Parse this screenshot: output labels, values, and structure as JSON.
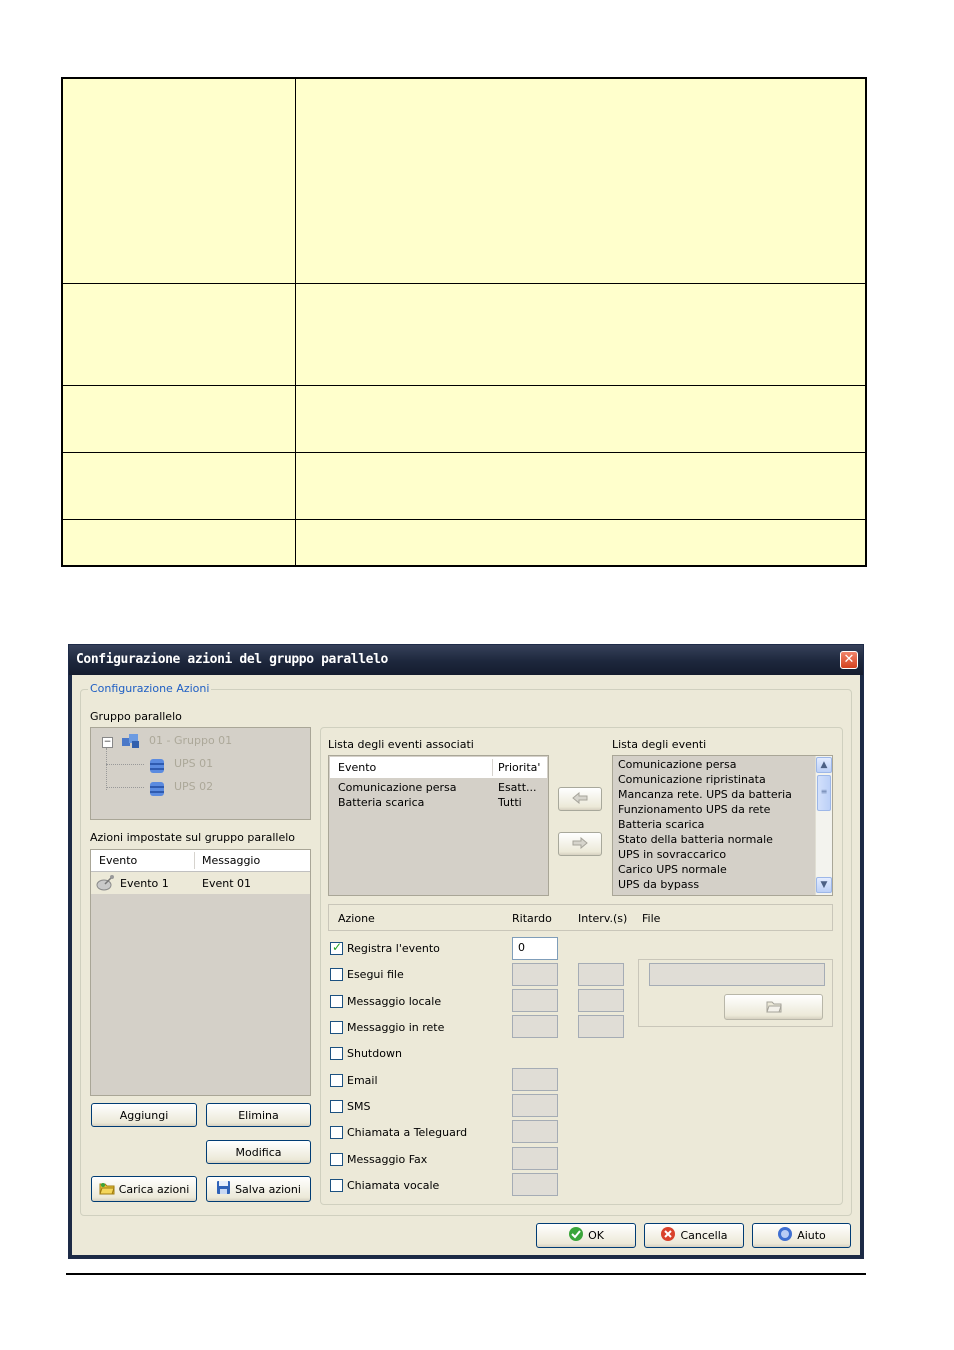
{
  "window": {
    "title": "Configurazione azioni del gruppo parallelo",
    "close_label": "✕"
  },
  "groupbox": {
    "legend": "Configurazione Azioni"
  },
  "tree": {
    "label": "Gruppo parallelo",
    "root": "01 - Gruppo 01",
    "children": [
      "UPS 01",
      "UPS 02"
    ]
  },
  "actions_list": {
    "label": "Azioni impostate sul gruppo parallelo",
    "columns": [
      "Evento",
      "Messaggio"
    ],
    "rows": [
      {
        "evento": "Evento 1",
        "messaggio": "Event 01"
      }
    ]
  },
  "left_buttons": {
    "add": "Aggiungi",
    "delete": "Elimina",
    "modify": "Modifica",
    "load": "Carica azioni",
    "save": "Salva azioni"
  },
  "assoc_events": {
    "label": "Lista degli eventi associati",
    "columns": [
      "Evento",
      "Priorita'"
    ],
    "rows": [
      {
        "evento": "Comunicazione persa",
        "priorita": "Esatt..."
      },
      {
        "evento": "Batteria scarica",
        "priorita": "Tutti"
      }
    ]
  },
  "events": {
    "label": "Lista degli eventi",
    "items": [
      "Comunicazione persa",
      "Comunicazione ripristinata",
      "Mancanza rete. UPS da batteria",
      "Funzionamento UPS da rete",
      "Batteria scarica",
      "Stato della batteria normale",
      "UPS in sovraccarico",
      "Carico UPS normale",
      "UPS da bypass"
    ]
  },
  "action_table": {
    "columns": {
      "azione": "Azione",
      "ritardo": "Ritardo",
      "interv": "Interv.(s)",
      "file": "File"
    },
    "rows": [
      {
        "label": "Registra l'evento",
        "checked": true,
        "ritardo": "0"
      },
      {
        "label": "Esegui file",
        "checked": false
      },
      {
        "label": "Messaggio locale",
        "checked": false
      },
      {
        "label": "Messaggio in rete",
        "checked": false
      },
      {
        "label": "Shutdown",
        "checked": false
      },
      {
        "label": "Email",
        "checked": false
      },
      {
        "label": "SMS",
        "checked": false
      },
      {
        "label": "Chiamata a Teleguard",
        "checked": false
      },
      {
        "label": "Messaggio Fax",
        "checked": false
      },
      {
        "label": "Chiamata vocale",
        "checked": false
      }
    ]
  },
  "footer_buttons": {
    "ok": "OK",
    "cancel": "Cancella",
    "help": "Aiuto"
  },
  "colors": {
    "table_background": "#ffffcc",
    "title_bar": "#1d273c",
    "dialog_face": "#ece9d8",
    "accent_blue": "#1f5fc4"
  }
}
